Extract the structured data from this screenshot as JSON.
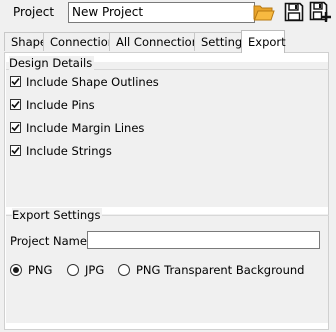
{
  "header": {
    "project_label": "Project",
    "project_value": "New Project"
  },
  "toolbar": {
    "open_icon": "folder-open-icon",
    "save_icon": "save-icon",
    "save_as_icon": "save-as-icon"
  },
  "tabs": [
    {
      "label": "Shape",
      "active": false
    },
    {
      "label": "Connection",
      "active": false
    },
    {
      "label": "All Connections",
      "active": false
    },
    {
      "label": "Settings",
      "active": false
    },
    {
      "label": "Export",
      "active": true
    }
  ],
  "design_details": {
    "title": "Design Details",
    "options": [
      {
        "label": "Include Shape Outlines",
        "checked": true
      },
      {
        "label": "Include Pins",
        "checked": true
      },
      {
        "label": "Include Margin Lines",
        "checked": true
      },
      {
        "label": "Include Strings",
        "checked": true
      }
    ]
  },
  "export_settings": {
    "title": "Export Settings",
    "project_name_label": "Project Name:",
    "project_name_value": "",
    "formats": [
      {
        "label": "PNG",
        "selected": true
      },
      {
        "label": "JPG",
        "selected": false
      },
      {
        "label": "PNG Transparent Background",
        "selected": false
      }
    ]
  },
  "colors": {
    "folder": "#f5a623",
    "background": "#f0f0f0"
  }
}
